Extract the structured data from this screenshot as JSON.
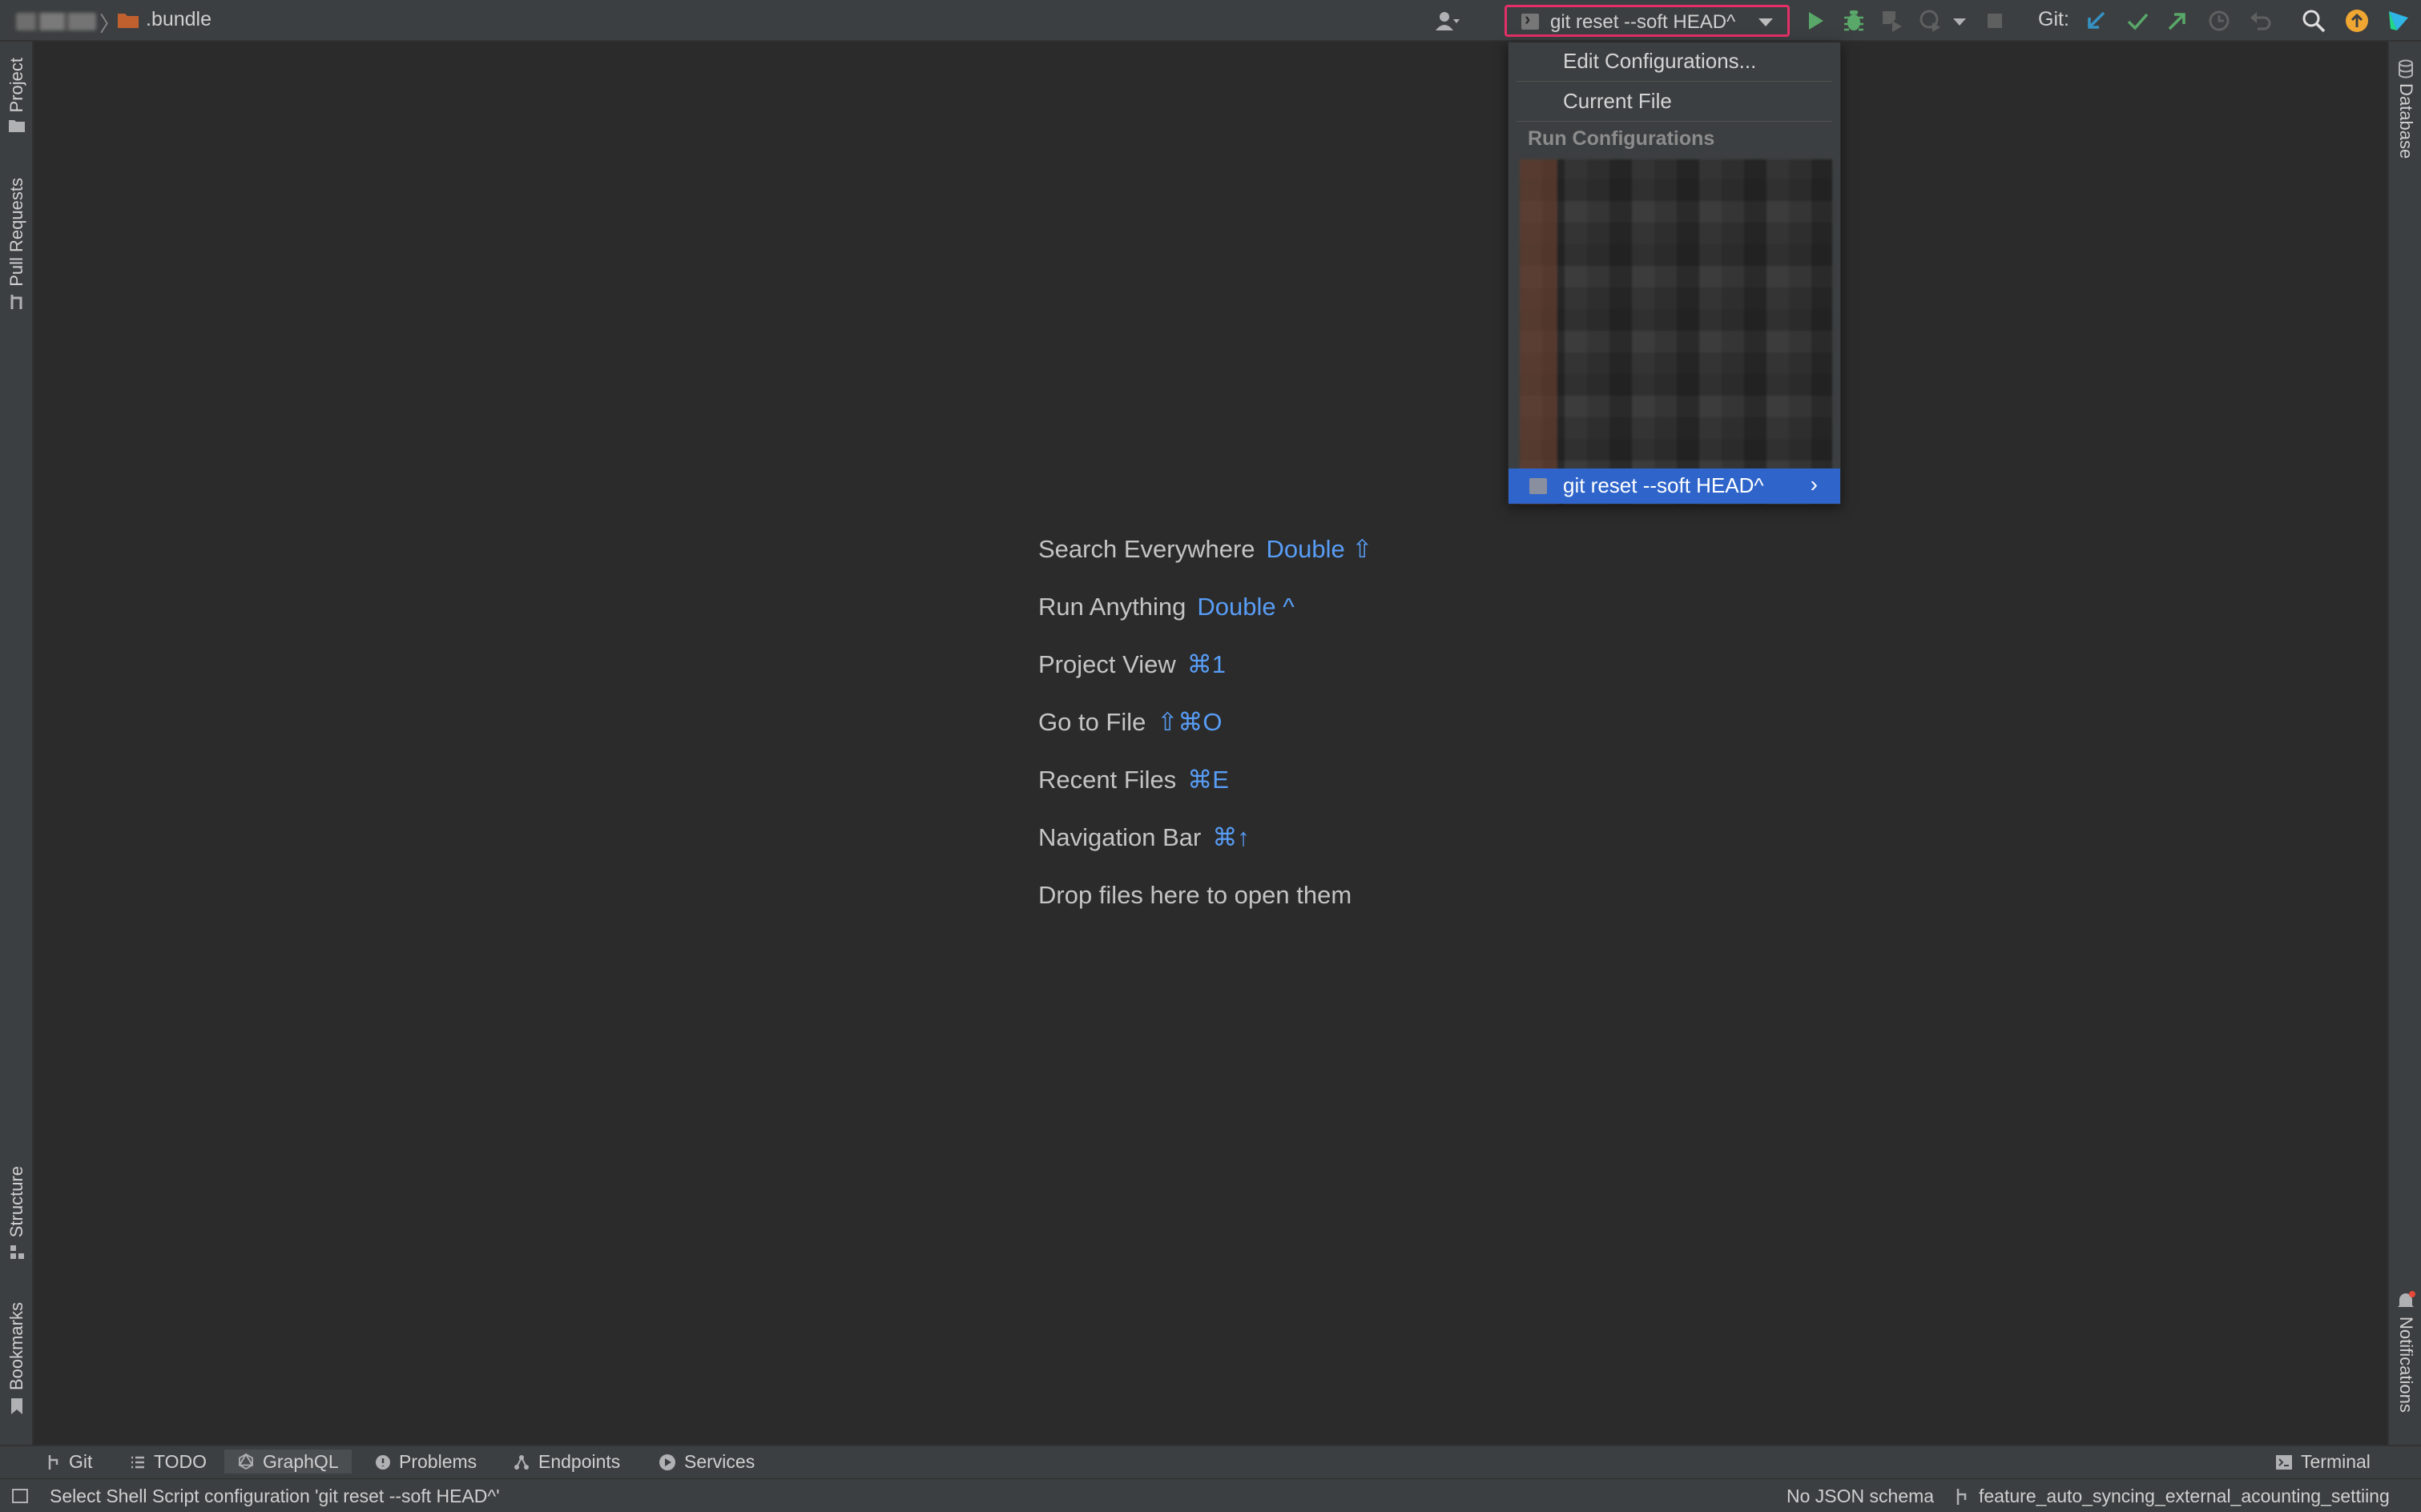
{
  "breadcrumb": {
    "project_label": ".bundle"
  },
  "toolbar": {
    "run_config_label": "git reset --soft HEAD^",
    "git_label": "Git:"
  },
  "run_dropdown": {
    "edit_configurations": "Edit Configurations...",
    "current_file": "Current File",
    "section_header": "Run Configurations",
    "selected_item": "git reset --soft HEAD^"
  },
  "left_stripe": {
    "project": "Project",
    "pull_requests": "Pull Requests",
    "structure": "Structure",
    "bookmarks": "Bookmarks"
  },
  "right_stripe": {
    "database": "Database",
    "notifications": "Notifications"
  },
  "welcome_hints": [
    {
      "label": "Search Everywhere",
      "shortcut": "Double ⇧"
    },
    {
      "label": "Run Anything",
      "shortcut": "Double ^"
    },
    {
      "label": "Project View",
      "shortcut": "⌘1"
    },
    {
      "label": "Go to File",
      "shortcut": "⇧⌘O"
    },
    {
      "label": "Recent Files",
      "shortcut": "⌘E"
    },
    {
      "label": "Navigation Bar",
      "shortcut": "⌘↑"
    },
    {
      "label": "Drop files here to open them",
      "shortcut": ""
    }
  ],
  "bottom_tools": {
    "git": "Git",
    "todo": "TODO",
    "graphql": "GraphQL",
    "problems": "Problems",
    "endpoints": "Endpoints",
    "services": "Services",
    "terminal": "Terminal"
  },
  "status": {
    "message": "Select Shell Script configuration 'git reset --soft HEAD^'",
    "json_schema": "No JSON schema",
    "branch": "feature_auto_syncing_external_acounting_settiing"
  },
  "colors": {
    "accent_selection": "#2f65ca",
    "shortcut_blue": "#589df6",
    "highlight_border": "#e43067",
    "run_green": "#59a869"
  }
}
